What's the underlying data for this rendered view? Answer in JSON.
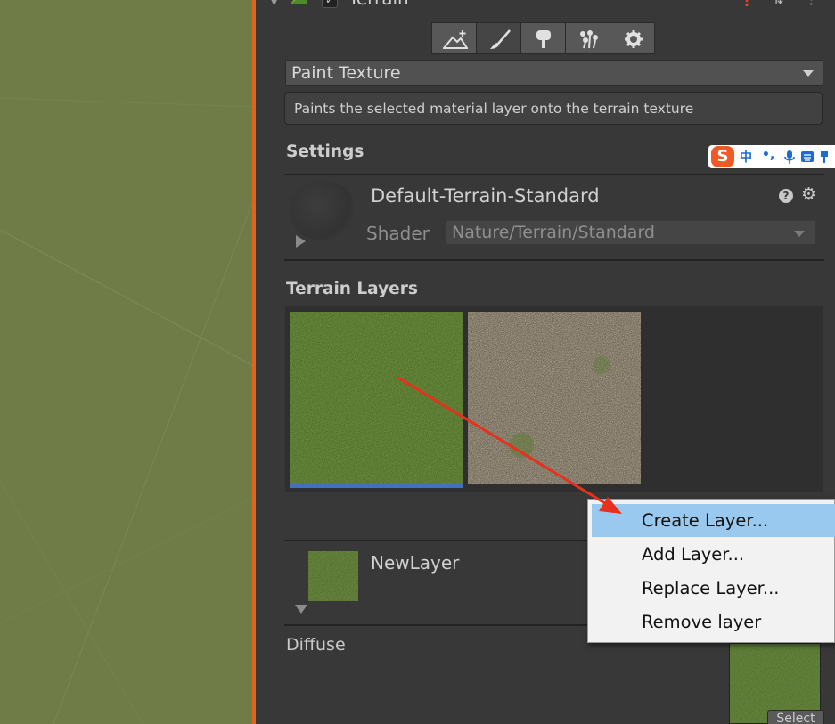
{
  "component": {
    "title": "Terrain",
    "enabled": true
  },
  "toolbar": {
    "tools": [
      {
        "name": "raise-lower-terrain",
        "active": false
      },
      {
        "name": "paint-texture",
        "active": true
      },
      {
        "name": "paint-trees",
        "active": false
      },
      {
        "name": "paint-details",
        "active": false
      },
      {
        "name": "terrain-settings",
        "active": false
      }
    ]
  },
  "tool_dropdown": {
    "value": "Paint Texture"
  },
  "help_text": "Paints the selected material layer onto the terrain texture",
  "settings": {
    "title": "Settings",
    "material_name": "Default-Terrain-Standard",
    "shader_label": "Shader",
    "shader_value": "Nature/Terrain/Standard"
  },
  "ime": {
    "logo": "S",
    "lang": "中"
  },
  "terrain_layers": {
    "title": "Terrain Layers",
    "layers": [
      {
        "texture": "grass",
        "selected": true
      },
      {
        "texture": "dry-ground",
        "selected": false
      }
    ]
  },
  "selected_layer": {
    "name": "NewLayer",
    "diffuse_label": "Diffuse",
    "select_label": "Select"
  },
  "context_menu": {
    "items": [
      {
        "label": "Create Layer...",
        "highlighted": true
      },
      {
        "label": "Add Layer...",
        "highlighted": false
      },
      {
        "label": "Replace Layer...",
        "highlighted": false
      },
      {
        "label": "Remove layer",
        "highlighted": false
      }
    ]
  },
  "colors": {
    "accent": "#e0651a",
    "selection": "#3f72c2",
    "menu_highlight": "#99c9ef",
    "annotation_arrow": "#e8301c"
  }
}
